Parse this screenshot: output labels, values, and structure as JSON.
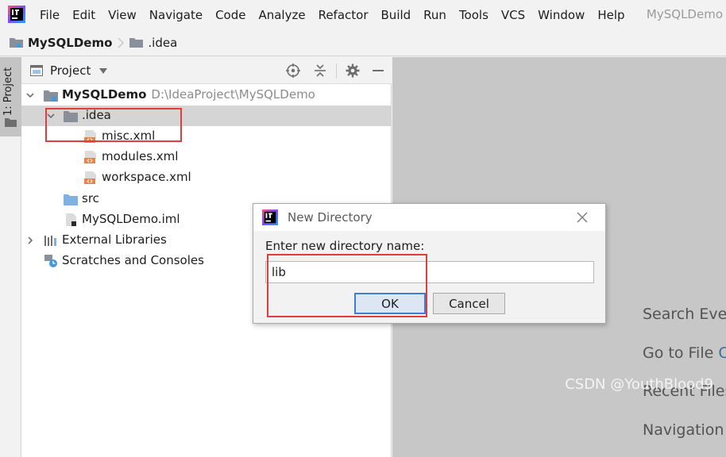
{
  "menubar": {
    "items": [
      "File",
      "Edit",
      "View",
      "Navigate",
      "Code",
      "Analyze",
      "Refactor",
      "Build",
      "Run",
      "Tools",
      "VCS",
      "Window",
      "Help"
    ],
    "window_title": "MySQLDemo"
  },
  "breadcrumb": {
    "root": "MySQLDemo",
    "child": ".idea"
  },
  "tool_stripe": {
    "project_tab": "1: Project"
  },
  "project_panel": {
    "title": "Project",
    "tree": [
      {
        "label": "MySQLDemo",
        "hint": "D:\\IdeaProject\\MySQLDemo",
        "icon": "module-folder-icon",
        "bold": true
      },
      {
        "label": ".idea",
        "icon": "folder-icon",
        "selected": true
      },
      {
        "label": "misc.xml",
        "icon": "xml-file-icon"
      },
      {
        "label": "modules.xml",
        "icon": "xml-file-icon"
      },
      {
        "label": "workspace.xml",
        "icon": "xml-file-icon"
      },
      {
        "label": "src",
        "icon": "source-folder-icon"
      },
      {
        "label": "MySQLDemo.iml",
        "icon": "iml-file-icon"
      },
      {
        "label": "External Libraries",
        "icon": "libraries-icon"
      },
      {
        "label": "Scratches and Consoles",
        "icon": "scratches-icon"
      }
    ]
  },
  "editor_hints": [
    {
      "text": "Search Eve",
      "key": ""
    },
    {
      "text": "Go to File ",
      "key": "C"
    },
    {
      "text": "Recent Files",
      "key": ""
    },
    {
      "text": "Navigation",
      "key": ""
    }
  ],
  "watermark": "CSDN @YouthBlood9",
  "dialog": {
    "title": "New Directory",
    "prompt": "Enter new directory name:",
    "input_value": "lib",
    "ok_label": "OK",
    "cancel_label": "Cancel"
  },
  "colors": {
    "selection": "#d5d5d5",
    "annotation": "#e43b3b",
    "ok_focus": "#3d7fd6",
    "editor_bg": "#c7c7c7"
  }
}
